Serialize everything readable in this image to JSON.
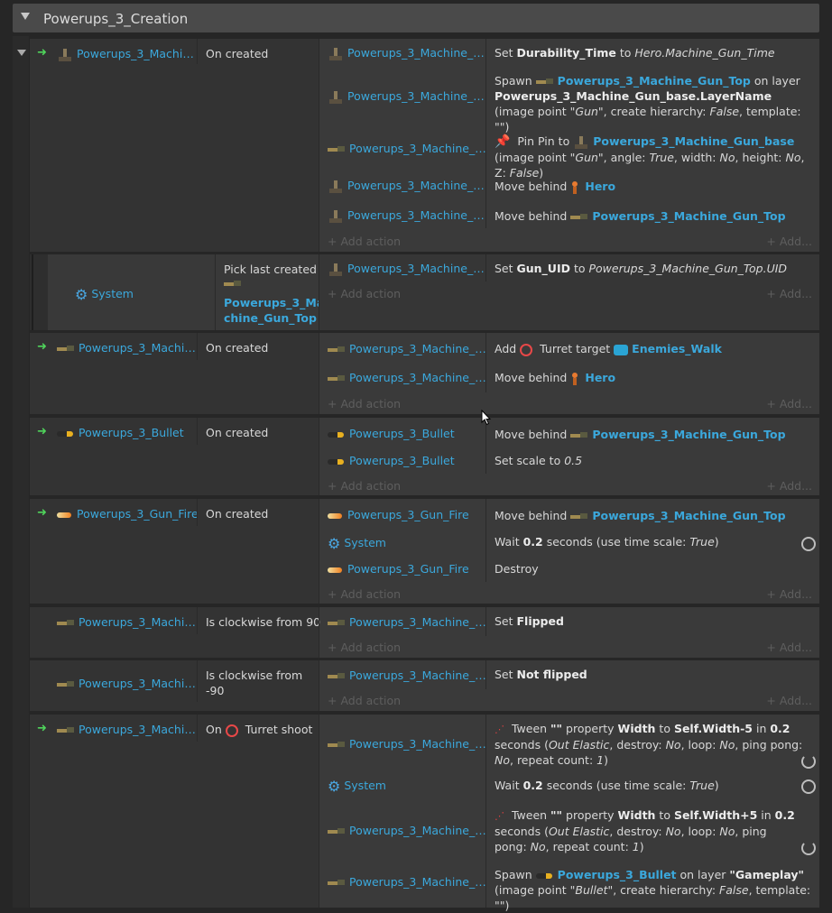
{
  "group": {
    "title": "Powerups_3_Creation"
  },
  "e1": {
    "cond_obj": "Powerups_3_Machi…",
    "cond_text": "On created",
    "rows": [
      {
        "obj": "Powerups_3_Machine_…"
      },
      {
        "obj": "Powerups_3_Machine_…"
      },
      {
        "obj": "Powerups_3_Machine_…"
      },
      {
        "obj": "Powerups_3_Machine_…"
      },
      {
        "obj": "Powerups_3_Machine_…"
      }
    ],
    "a1_pre": "Set ",
    "a1_var": "Durability_Time",
    "a1_mid": " to ",
    "a1_val": "Hero.Machine_Gun_Time",
    "a2_pre": "Spawn ",
    "a2_obj": "Powerups_3_Machine_Gun_Top",
    "a2_mid": " on layer ",
    "a2_layer": "Powerups_3_Machine_Gun_base.LayerName",
    "a2_rest1": " (image point ",
    "a2_q1": "\"Gun\"",
    "a2_rest2": ", create hierarchy: ",
    "a2_f": "False",
    "a2_rest3": ", template: \"\")",
    "a3_pre": " Pin Pin to ",
    "a3_obj": "Powerups_3_Machine_Gun_base",
    "a3_rest1": " (image point ",
    "a3_q": "\"Gun\"",
    "a3_rest2": ", angle: ",
    "a3_t": "True",
    "a3_rest3": ", width: ",
    "a3_no": "No",
    "a3_rest4": ", height: ",
    "a3_no2": "No",
    "a3_rest5": ", Z: ",
    "a3_f": "False",
    "a3_rest6": ")",
    "a4_pre": "Move behind ",
    "a4_obj": "Hero",
    "a5_pre": "Move behind ",
    "a5_obj": "Powerups_3_Machine_Gun_Top",
    "add_action": "+ Add action",
    "add_right": "+ Add..."
  },
  "sub1": {
    "cond_obj": "System",
    "cond_text1": "Pick last created",
    "cond_obj2a": "Powerups_3_Ma",
    "cond_obj2b": "chine_Gun_Top",
    "row_obj": "Powerups_3_Machine_…",
    "a_pre": "Set ",
    "a_var": "Gun_UID",
    "a_mid": " to ",
    "a_val": "Powerups_3_Machine_Gun_Top.UID",
    "add_action": "+ Add action",
    "add_right": "+ Add..."
  },
  "e2": {
    "cond_obj": "Powerups_3_Machi…",
    "cond_text": "On created",
    "r1": "Powerups_3_Machine_…",
    "r2": "Powerups_3_Machine_…",
    "a1_pre": "Add ",
    "a1_mid": " Turret target ",
    "a1_obj": "Enemies_Walk",
    "a2_pre": "Move behind ",
    "a2_obj": "Hero",
    "add_action": "+ Add action",
    "add_right": "+ Add..."
  },
  "e3": {
    "cond_obj": "Powerups_3_Bullet",
    "cond_text": "On created",
    "r1": "Powerups_3_Bullet",
    "r2": "Powerups_3_Bullet",
    "a1_pre": "Move behind ",
    "a1_obj": "Powerups_3_Machine_Gun_Top",
    "a2_pre": "Set scale to ",
    "a2_val": "0.5",
    "add_action": "+ Add action",
    "add_right": "+ Add..."
  },
  "e4": {
    "cond_obj": "Powerups_3_Gun_Fire",
    "cond_text": "On created",
    "r1": "Powerups_3_Gun_Fire",
    "r2": "System",
    "r3": "Powerups_3_Gun_Fire",
    "a1_pre": "Move behind ",
    "a1_obj": "Powerups_3_Machine_Gun_Top",
    "a2_pre": "Wait ",
    "a2_val": "0.2",
    "a2_rest": " seconds (use time scale: ",
    "a2_t": "True",
    "a2_end": ")",
    "a3": "Destroy",
    "add_action": "+ Add action",
    "add_right": "+ Add..."
  },
  "e5": {
    "cond_obj": "Powerups_3_Machi…",
    "cond_text": "Is clockwise from 90",
    "r1": "Powerups_3_Machine_…",
    "a1_pre": "Set ",
    "a1_val": "Flipped",
    "add_action": "+ Add action",
    "add_right": "+ Add..."
  },
  "e6": {
    "cond_obj": "Powerups_3_Machi…",
    "cond_text1": "Is clockwise from",
    "cond_text2": "-90",
    "r1": "Powerups_3_Machine_…",
    "a1_pre": "Set ",
    "a1_val": "Not flipped",
    "add_action": "+ Add action",
    "add_right": "+ Add..."
  },
  "e7": {
    "cond_obj": "Powerups_3_Machi…",
    "cond_text_pre": "On",
    "cond_text": " Turret shoot",
    "r1": "Powerups_3_Machine_…",
    "r2": "System",
    "r3": "Powerups_3_Machine_…",
    "r4": "Powerups_3_Machine_…",
    "a1_l1_pre": " Tween ",
    "a1_q": "\"\"",
    "a1_l1_mid": " property ",
    "a1_prop": "Width",
    "a1_to": " to ",
    "a1_expr": "Self.Width-5",
    "a1_in": " in ",
    "a1_sec": "0.2",
    "a1_secs": " seconds",
    "a1_l2": "(",
    "a1_ease": "Out Elastic",
    "a1_l2b": ", destroy: ",
    "a1_no": "No",
    "a1_l2c": ", loop: ",
    "a1_no2": "No",
    "a1_l2d": ", ping pong: ",
    "a1_no3": "No",
    "a1_l2e": ", repeat",
    "a1_l3": "count: ",
    "a1_one": "1",
    "a1_l3b": ")",
    "a2_pre": "Wait ",
    "a2_val": "0.2",
    "a2_rest": " seconds (use time scale: ",
    "a2_t": "True",
    "a2_end": ")",
    "a3_l1_pre": " Tween ",
    "a3_q": "\"\"",
    "a3_l1_mid": " property ",
    "a3_prop": "Width",
    "a3_to": " to ",
    "a3_expr": "Self.Width+5",
    "a3_in": " in ",
    "a3_sec": "0.2",
    "a3_l2": "seconds (",
    "a3_ease": "Out Elastic",
    "a3_l2b": ", destroy: ",
    "a3_no": "No",
    "a3_l2c": ", loop: ",
    "a3_no2": "No",
    "a3_l2d": ", ping pong: ",
    "a3_no3": "No",
    "a3_l2e": ",",
    "a3_l3": "repeat count: ",
    "a3_one": "1",
    "a3_l3b": ")",
    "a4_pre": "Spawn ",
    "a4_obj": "Powerups_3_Bullet",
    "a4_mid": " on layer ",
    "a4_layer": "\"Gameplay\"",
    "a4_rest": " (image",
    "a4_l2": "point ",
    "a4_q": "\"Bullet\"",
    "a4_l2b": ", create hierarchy: ",
    "a4_f": "False",
    "a4_l2c": ", template: \"\")"
  },
  "colors": {
    "accent": "#3ba8dc",
    "trigger": "#4fd45b",
    "bg": "#262626",
    "event_bg": "#3a3a3a"
  }
}
